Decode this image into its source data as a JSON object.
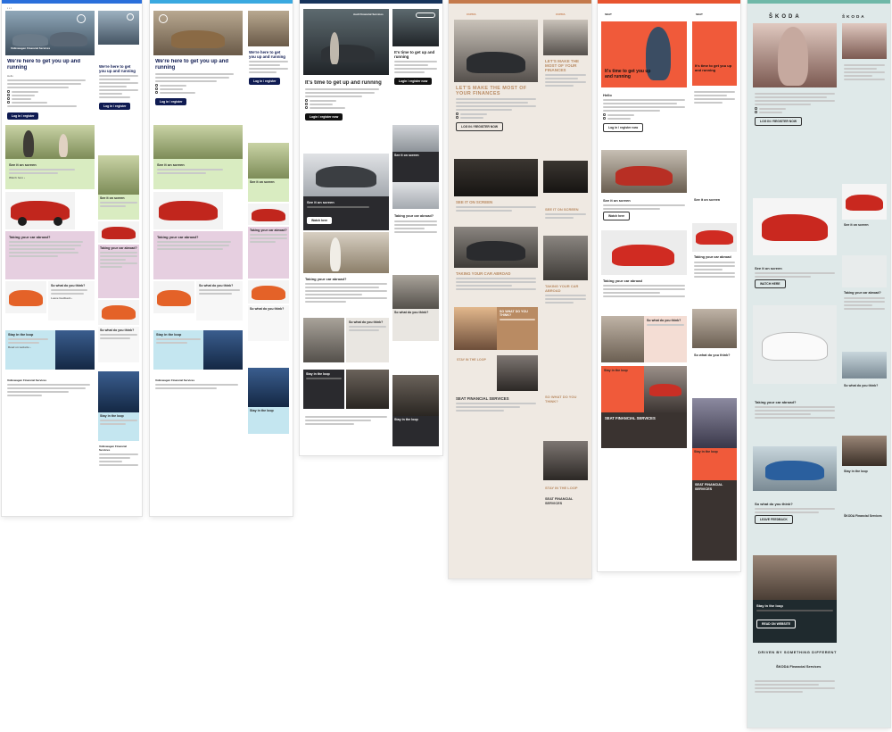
{
  "emails": {
    "vw_desktop": {
      "brand_name": "Volkswagen Financial Services",
      "headline": "We're here to get you up and running",
      "greeting": "Hello",
      "cta": "Log in / register",
      "see_it": "See it on screen",
      "taking_abroad": "Taking your car abroad?",
      "what_think": "So what do you think?",
      "stay_loop": "Stay in the loop",
      "footer_brand": "Volkswagen Financial Services",
      "accent": "#0f1b52"
    },
    "vw_mobile": {
      "headline": "We're here to get you up and running",
      "cta": "Log in / register",
      "see_it": "See it on screen",
      "taking_abroad": "Taking your car abroad?",
      "what_think": "So what do you think?",
      "stay_loop": "Stay in the loop",
      "footer_brand": "Volkswagen Financial Services"
    },
    "vw2_desktop": {
      "headline": "We're here to get you up and running",
      "cta": "Log in / register",
      "see_it": "See it on screen",
      "taking_abroad": "Taking your car abroad?",
      "what_think": "So what do you think?",
      "stay_loop": "Stay in the loop",
      "footer_brand": "Volkswagen Financial Services"
    },
    "vw2_mobile": {
      "headline": "We're here to get you up and running",
      "cta": "Log in / register",
      "see_it": "See it on screen",
      "taking_abroad": "Taking your car abroad?",
      "what_think": "So what do you think?",
      "stay_loop": "Stay in the loop"
    },
    "audi_desktop": {
      "brand_name": "Audi Financial Services",
      "headline": "It's time to get up and running",
      "cta": "Login / register now",
      "see_it": "See it on screen",
      "taking_abroad": "Taking your car abroad?",
      "what_think": "So what do you think?",
      "stay_loop": "Stay in the loop"
    },
    "audi_mobile": {
      "headline": "It's time to get up and running",
      "cta": "Login / register now",
      "see_it": "See it on screen",
      "taking_abroad": "Taking your car abroad?",
      "what_think": "So what do you think?",
      "stay_loop": "Stay in the loop"
    },
    "cupra_desktop": {
      "brand_name": "CUPRA",
      "headline": "LET'S MAKE THE MOST OF YOUR FINANCES",
      "see_it": "SEE IT ON SCREEN",
      "taking_abroad": "TAKING YOUR CAR ABROAD",
      "what_think": "SO WHAT DO YOU THINK?",
      "stay_loop": "STAY IN THE LOOP",
      "footer_brand": "SEAT FINANCIAL SERVICES"
    },
    "cupra_mobile": {
      "brand_name": "CUPRA",
      "headline": "LET'S MAKE THE MOST OF YOUR FINANCES",
      "see_it": "SEE IT ON SCREEN",
      "taking_abroad": "TAKING YOUR CAR ABROAD",
      "what_think": "SO WHAT DO YOU THINK?",
      "stay_loop": "STAY IN THE LOOP",
      "footer_brand": "SEAT FINANCIAL SERVICES"
    },
    "seat_desktop": {
      "brand_name": "SEAT",
      "headline": "It's time to get you up and running",
      "greeting": "Hello",
      "see_it": "See it on screen",
      "taking_abroad": "Taking your car abroad",
      "what_think": "So what do you think?",
      "stay_loop": "Stay in the loop",
      "footer_brand": "SEAT FINANCIAL SERVICES"
    },
    "seat_mobile": {
      "brand_name": "SEAT",
      "headline": "It's time to get you up and running",
      "see_it": "See it on screen",
      "taking_abroad": "Taking your car abroad",
      "what_think": "So what do you think?",
      "stay_loop": "Stay in the loop",
      "footer_brand": "SEAT FINANCIAL SERVICES"
    },
    "skoda_desktop": {
      "brand_name": "ŠKODA",
      "see_it": "See it on screen",
      "taking_abroad": "Taking your car abroad?",
      "what_think": "So what do you think?",
      "stay_loop": "Stay in the loop",
      "tagline": "DRIVEN BY SOMETHING DIFFERENT",
      "footer_brand": "ŠKODA Financial Services"
    },
    "skoda_mobile": {
      "brand_name": "ŠKODA",
      "see_it": "See it on screen",
      "taking_abroad": "Taking your car abroad?",
      "what_think": "So what do you think?",
      "stay_loop": "Stay in the loop",
      "footer_brand": "ŠKODA Financial Services"
    }
  },
  "colors": {
    "vw_navy": "#0f1b52",
    "vw_green": "#d9ecc1",
    "vw_pink": "#e6cfe0",
    "vw_blue": "#c4e6f0",
    "audi_dark": "#2a2a2e",
    "cupra_sand": "#e9dccb",
    "cupra_copper": "#b98b63",
    "seat_orange": "#f05a3a",
    "skoda_green": "#d5e6e4",
    "skoda_dark": "#1f2a2e"
  }
}
